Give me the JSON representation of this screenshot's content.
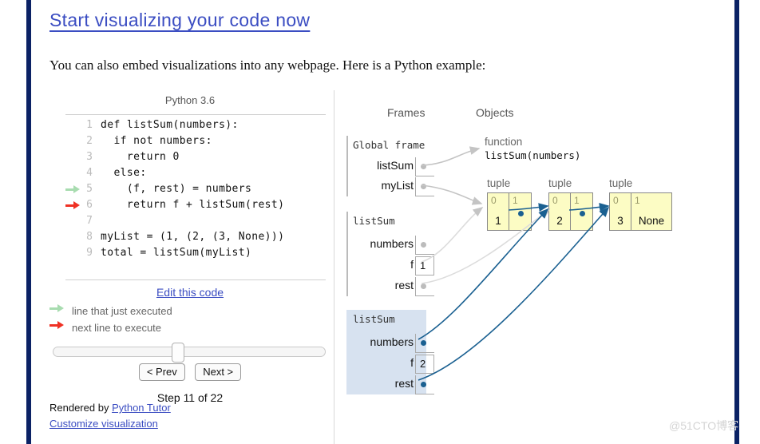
{
  "page": {
    "title": "Start visualizing your code now",
    "intro": "You can also embed visualizations into any webpage. Here is a Python example:",
    "watermark": "@51CTO博客"
  },
  "code_panel": {
    "language": "Python 3.6",
    "lines": [
      {
        "num": "1",
        "text": "def listSum(numbers):",
        "marker": "none"
      },
      {
        "num": "2",
        "text": "  if not numbers:",
        "marker": "none"
      },
      {
        "num": "3",
        "text": "    return 0",
        "marker": "none"
      },
      {
        "num": "4",
        "text": "  else:",
        "marker": "none"
      },
      {
        "num": "5",
        "text": "    (f, rest) = numbers",
        "marker": "green"
      },
      {
        "num": "6",
        "text": "    return f + listSum(rest)",
        "marker": "red"
      },
      {
        "num": "7",
        "text": "",
        "marker": "none"
      },
      {
        "num": "8",
        "text": "myList = (1, (2, (3, None)))",
        "marker": "none"
      },
      {
        "num": "9",
        "text": "total = listSum(myList)",
        "marker": "none"
      }
    ],
    "edit_link": "Edit this code",
    "legend": {
      "executed": "line that just executed",
      "next": "next line to execute"
    },
    "controls": {
      "prev_label": "< Prev",
      "next_label": "Next >",
      "step_text": "Step 11 of 22"
    },
    "footer": {
      "rendered_by_prefix": "Rendered by ",
      "rendered_by_link": "Python Tutor",
      "customize_link": "Customize visualization"
    }
  },
  "visualization": {
    "headers": {
      "frames": "Frames",
      "objects": "Objects"
    },
    "frames": [
      {
        "title": "Global frame",
        "active": false,
        "vars": [
          {
            "name": "listSum",
            "value": "",
            "pointer": true
          },
          {
            "name": "myList",
            "value": "",
            "pointer": true
          }
        ]
      },
      {
        "title": "listSum",
        "active": false,
        "vars": [
          {
            "name": "numbers",
            "value": "",
            "pointer": true
          },
          {
            "name": "f",
            "value": "1",
            "pointer": false
          },
          {
            "name": "rest",
            "value": "",
            "pointer": true
          }
        ]
      },
      {
        "title": "listSum",
        "active": true,
        "vars": [
          {
            "name": "numbers",
            "value": "",
            "pointer": true
          },
          {
            "name": "f",
            "value": "2",
            "pointer": false
          },
          {
            "name": "rest",
            "value": "",
            "pointer": true
          }
        ]
      }
    ],
    "function_object": {
      "kind": "function",
      "signature": "listSum(numbers)"
    },
    "tuples": [
      {
        "label": "tuple",
        "cells": [
          {
            "index": "0",
            "value": "1"
          },
          {
            "index": "1",
            "value": ""
          }
        ]
      },
      {
        "label": "tuple",
        "cells": [
          {
            "index": "0",
            "value": "2"
          },
          {
            "index": "1",
            "value": ""
          }
        ]
      },
      {
        "label": "tuple",
        "cells": [
          {
            "index": "0",
            "value": "3"
          },
          {
            "index": "1",
            "value": "None"
          }
        ]
      }
    ]
  },
  "colors": {
    "accent_navy": "#0b2265",
    "link_blue": "#3b4dc2",
    "tuple_fill": "#fcfcc4",
    "active_frame": "#d7e2f0",
    "pointer_blue": "#1a6091",
    "pointer_gray": "#bcbcbc",
    "green_arrow": "#a8dcb0",
    "red_arrow": "#ef3124"
  }
}
